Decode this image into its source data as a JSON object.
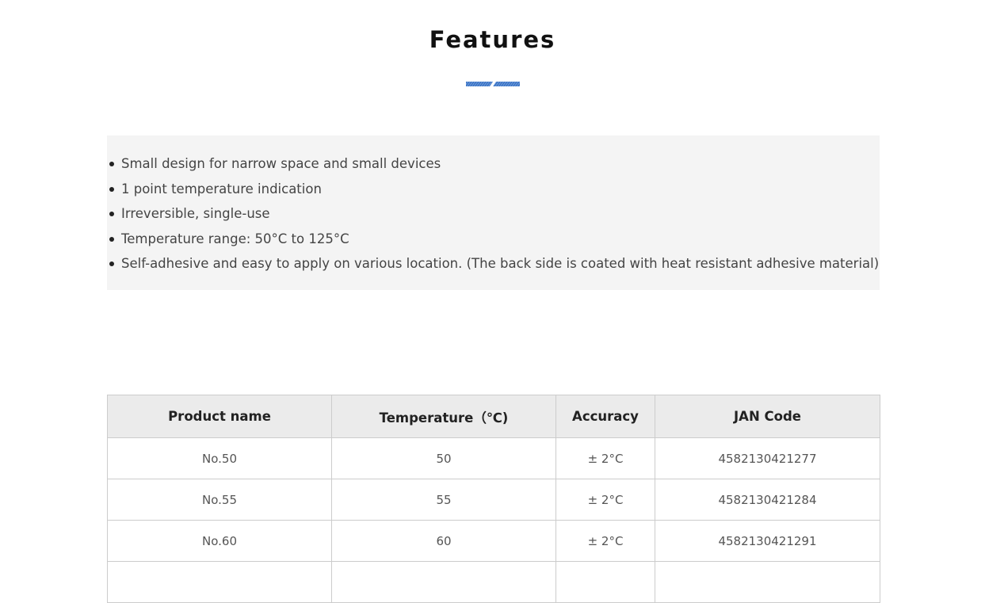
{
  "section": {
    "title": "Features",
    "accent_color": "#3a73c4"
  },
  "features": [
    "Small design for narrow space and small devices",
    "1 point temperature indication",
    "Irreversible, single-use",
    "Temperature range: 50°C to 125°C",
    "Self-adhesive and easy to apply on various location. (The back side is coated with heat resistant adhesive material)"
  ],
  "table": {
    "headers": [
      "Product name",
      "Temperature（℃)",
      "Accuracy",
      "JAN Code"
    ],
    "rows": [
      [
        "No.50",
        "50",
        "± 2°C",
        "4582130421277"
      ],
      [
        "No.55",
        "55",
        "± 2°C",
        "4582130421284"
      ],
      [
        "No.60",
        "60",
        "± 2°C",
        "4582130421291"
      ]
    ]
  }
}
